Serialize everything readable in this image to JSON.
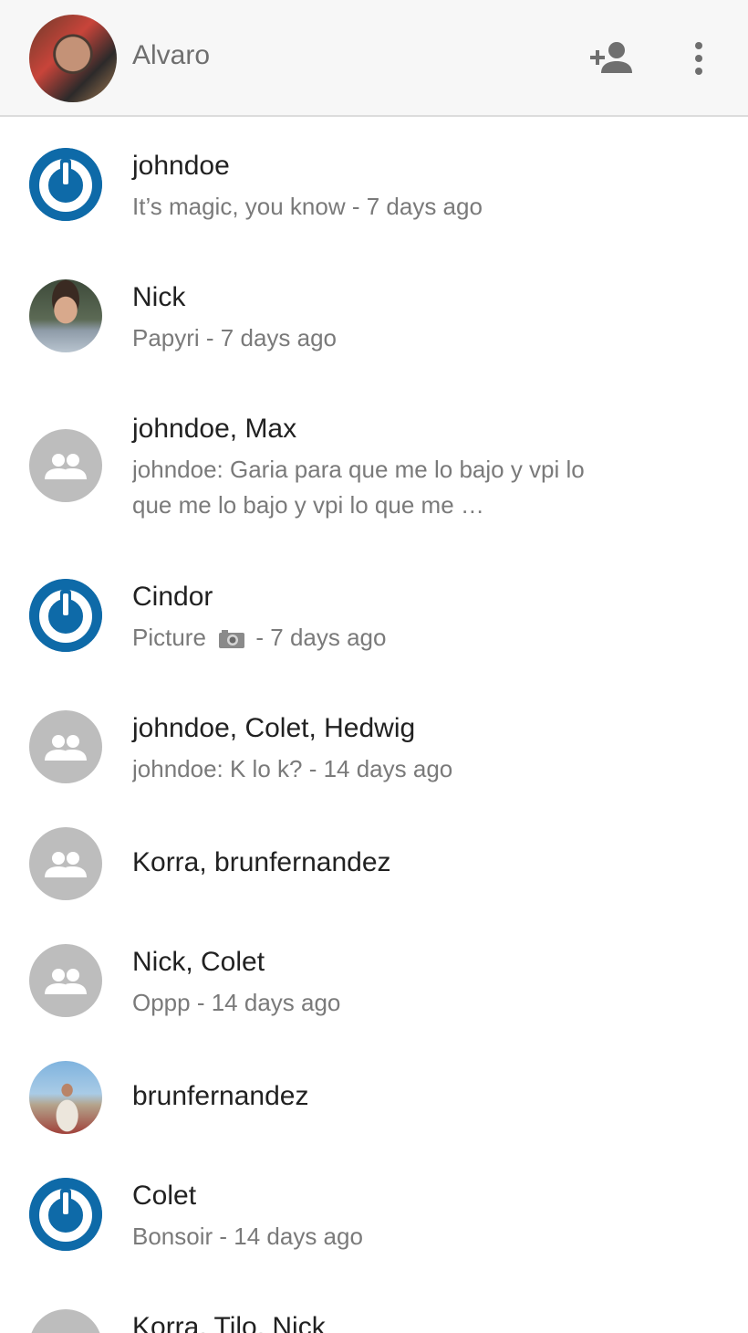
{
  "header": {
    "user_name": "Alvaro",
    "add_contact_icon": "person-add-icon",
    "more_icon": "more-vert-icon"
  },
  "colors": {
    "brand_blue": "#0e6aa8",
    "group_gray": "#bdbdbd",
    "header_bg": "#f7f7f7",
    "secondary_text": "#7a7a7a"
  },
  "conversations": [
    {
      "name": "johndoe",
      "preview": "It’s magic, you know - 7 days ago",
      "avatar": "power-logo"
    },
    {
      "name": "Nick",
      "preview": "Papyri - 7 days ago",
      "avatar": "photo"
    },
    {
      "name": "johndoe, Max",
      "preview": "johndoe: Garia para que me lo bajo y vpi lo que me lo bajo y vpi lo que me …",
      "avatar": "group-icon"
    },
    {
      "name": "Cindor",
      "preview_a": "Picture",
      "preview_icon": "camera-icon",
      "preview_b": "- 7 days ago",
      "avatar": "power-logo"
    },
    {
      "name": "johndoe, Colet, Hedwig",
      "preview": "johndoe: K lo k? - 14 days ago",
      "avatar": "group-icon"
    },
    {
      "name": "Korra, brunfernandez",
      "preview": "",
      "avatar": "group-icon"
    },
    {
      "name": "Nick, Colet",
      "preview": "Oppp - 14 days ago",
      "avatar": "group-icon"
    },
    {
      "name": "brunfernandez",
      "preview": "",
      "avatar": "photo"
    },
    {
      "name": "Colet",
      "preview": "Bonsoir - 14 days ago",
      "avatar": "power-logo"
    },
    {
      "name": "Korra, Tilo, Nick",
      "preview": "",
      "avatar": "group-icon"
    }
  ]
}
